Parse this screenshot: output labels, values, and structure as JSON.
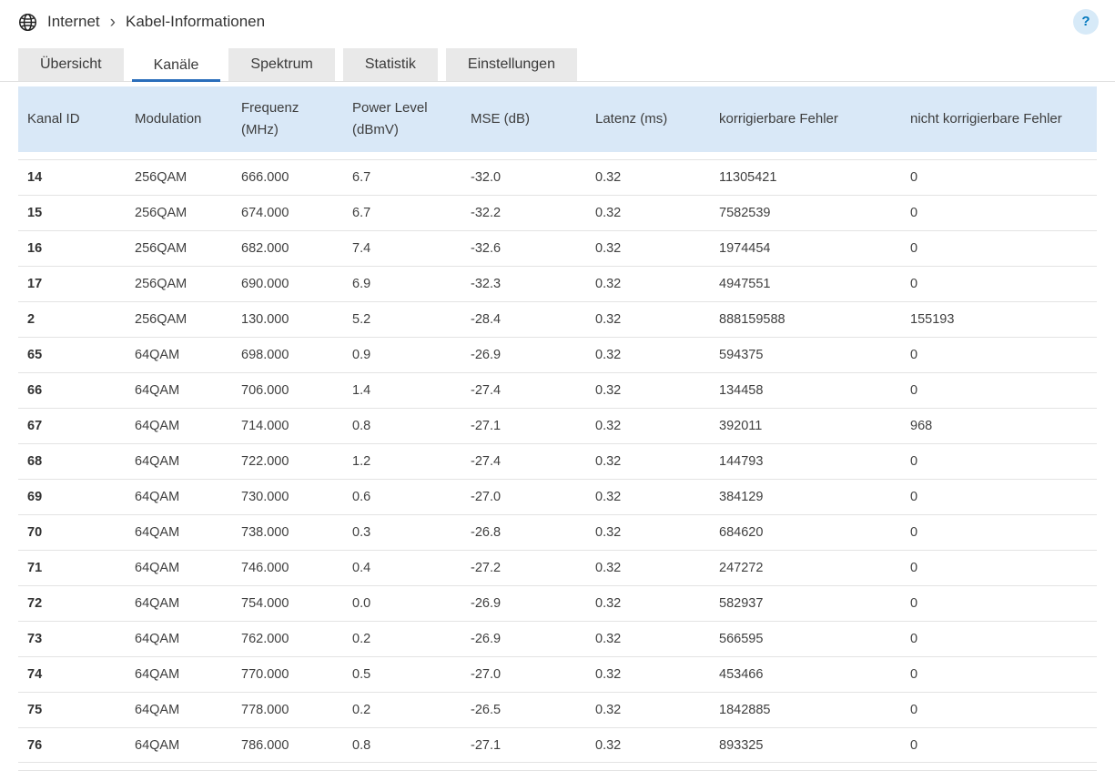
{
  "header": {
    "breadcrumb": {
      "root": "Internet",
      "current": "Kabel-Informationen"
    },
    "help_label": "?"
  },
  "tabs": [
    {
      "label": "Übersicht",
      "active": false
    },
    {
      "label": "Kanäle",
      "active": true
    },
    {
      "label": "Spektrum",
      "active": false
    },
    {
      "label": "Statistik",
      "active": false
    },
    {
      "label": "Einstellungen",
      "active": false
    }
  ],
  "table": {
    "columns": [
      "Kanal ID",
      "Modulation",
      "Frequenz (MHz)",
      "Power Level\n(dBmV)",
      "MSE (dB)",
      "Latenz (ms)",
      "korrigierbare Fehler",
      "nicht korrigierbare Fehler"
    ],
    "rows": [
      [
        "14",
        "256QAM",
        "666.000",
        "6.7",
        "-32.0",
        "0.32",
        "11305421",
        "0"
      ],
      [
        "15",
        "256QAM",
        "674.000",
        "6.7",
        "-32.2",
        "0.32",
        "7582539",
        "0"
      ],
      [
        "16",
        "256QAM",
        "682.000",
        "7.4",
        "-32.6",
        "0.32",
        "1974454",
        "0"
      ],
      [
        "17",
        "256QAM",
        "690.000",
        "6.9",
        "-32.3",
        "0.32",
        "4947551",
        "0"
      ],
      [
        "2",
        "256QAM",
        "130.000",
        "5.2",
        "-28.4",
        "0.32",
        "888159588",
        "155193"
      ],
      [
        "65",
        "64QAM",
        "698.000",
        "0.9",
        "-26.9",
        "0.32",
        "594375",
        "0"
      ],
      [
        "66",
        "64QAM",
        "706.000",
        "1.4",
        "-27.4",
        "0.32",
        "134458",
        "0"
      ],
      [
        "67",
        "64QAM",
        "714.000",
        "0.8",
        "-27.1",
        "0.32",
        "392011",
        "968"
      ],
      [
        "68",
        "64QAM",
        "722.000",
        "1.2",
        "-27.4",
        "0.32",
        "144793",
        "0"
      ],
      [
        "69",
        "64QAM",
        "730.000",
        "0.6",
        "-27.0",
        "0.32",
        "384129",
        "0"
      ],
      [
        "70",
        "64QAM",
        "738.000",
        "0.3",
        "-26.8",
        "0.32",
        "684620",
        "0"
      ],
      [
        "71",
        "64QAM",
        "746.000",
        "0.4",
        "-27.2",
        "0.32",
        "247272",
        "0"
      ],
      [
        "72",
        "64QAM",
        "754.000",
        "0.0",
        "-26.9",
        "0.32",
        "582937",
        "0"
      ],
      [
        "73",
        "64QAM",
        "762.000",
        "0.2",
        "-26.9",
        "0.32",
        "566595",
        "0"
      ],
      [
        "74",
        "64QAM",
        "770.000",
        "0.5",
        "-27.0",
        "0.32",
        "453466",
        "0"
      ],
      [
        "75",
        "64QAM",
        "778.000",
        "0.2",
        "-26.5",
        "0.32",
        "1842885",
        "0"
      ],
      [
        "76",
        "64QAM",
        "786.000",
        "0.8",
        "-27.1",
        "0.32",
        "893325",
        "0"
      ]
    ]
  },
  "colors": {
    "table_header_bg": "#d9e8f7",
    "accent_blue": "#2a6ebb",
    "help_bg": "#d7eaf8",
    "help_fg": "#0077bd",
    "tab_bg": "#e9e9e9",
    "border": "#e3e3e3",
    "text": "#3c3c3c"
  }
}
